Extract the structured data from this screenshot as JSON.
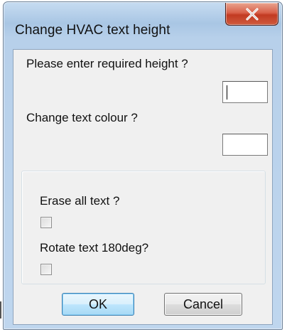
{
  "window": {
    "title": "Change HVAC text height",
    "close_icon": "close-x-icon"
  },
  "form": {
    "height_prompt": "Please enter required height ?",
    "height_value": "",
    "colour_prompt": "Change text colour ?",
    "colour_value": "",
    "erase_label": "Erase all text ?",
    "erase_checked": false,
    "rotate_label": "Rotate text 180deg?",
    "rotate_checked": false
  },
  "buttons": {
    "ok_label": "OK",
    "cancel_label": "Cancel"
  },
  "colors": {
    "titlebar": "#b7d0ea",
    "close_button": "#c23a22",
    "client_background": "#f0f0f0",
    "default_button_border": "#3c7fb1"
  }
}
